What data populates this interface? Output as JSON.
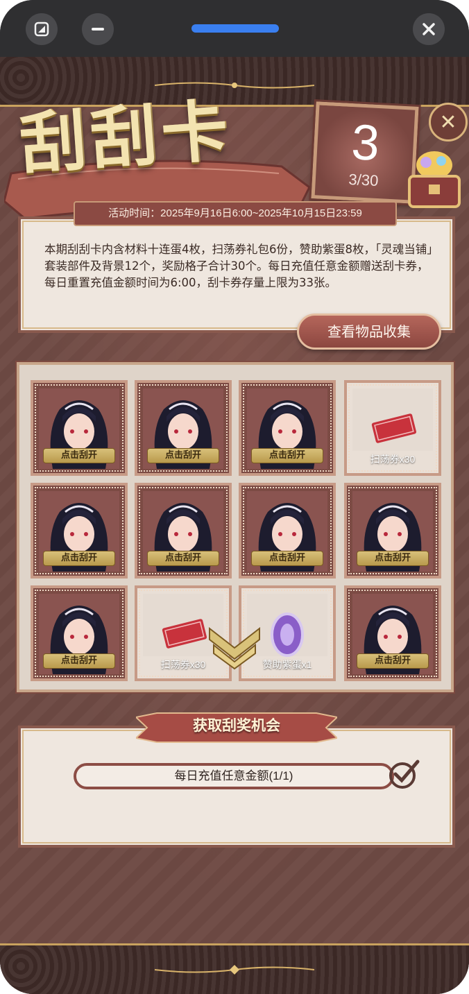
{
  "title": "刮刮卡",
  "counter": {
    "value": "3",
    "progress": "3/30"
  },
  "event_time": "活动时间：2025年9月16日6:00~2025年10月15日23:59",
  "description": "本期刮刮卡内含材料十连蛋4枚，扫荡券礼包6份，赞助紫蛋8枚，「灵魂当铺」套装部件及背景12个，奖励格子合计30个。每日充值任意金额赠送刮卡券，每日重置充值金额时间为6:00，刮卡券存量上限为33张。",
  "collection_button": "查看物品收集",
  "grid": {
    "scratch_label": "点击刮开",
    "prizes": {
      "ticket_1": "扫荡券x30",
      "ticket_2": "扫荡券x30",
      "egg": "赞助紫蛋x1"
    }
  },
  "chance_section": {
    "title": "获取刮奖机会",
    "task": "每日充值任意金额(1/1)"
  },
  "colors": {
    "accent": "#8b4a43",
    "gold": "#c9a25e",
    "status_pill": "#3a7ff0"
  }
}
